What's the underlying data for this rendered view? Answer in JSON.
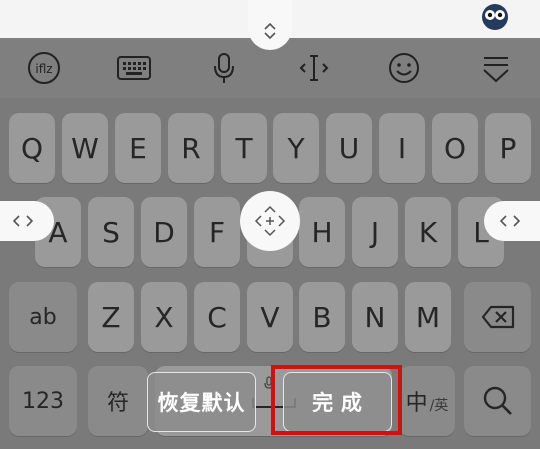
{
  "colors": {
    "keyboard_bg": "#7a7a7a",
    "key_bg": "#9a9a9a",
    "highlight": "#d40f0f"
  },
  "toolbar": {
    "icons": [
      "logo-icon",
      "keyboard-icon",
      "microphone-icon",
      "text-cursor-icon",
      "emoji-icon",
      "collapse-keyboard-icon"
    ]
  },
  "keyboard": {
    "row1": [
      "Q",
      "W",
      "E",
      "R",
      "T",
      "Y",
      "U",
      "I",
      "O",
      "P"
    ],
    "row2": [
      "A",
      "S",
      "D",
      "F",
      "G",
      "H",
      "J",
      "K",
      "L"
    ],
    "row3": [
      "ab",
      "Z",
      "X",
      "C",
      "V",
      "B",
      "N",
      "M"
    ],
    "numbers_key": "123",
    "symbols_key": "符",
    "lang_key_main": "中",
    "lang_key_sub": "/英"
  },
  "overlay": {
    "restore_default_label": "恢复默认",
    "done_label": "完 成"
  }
}
